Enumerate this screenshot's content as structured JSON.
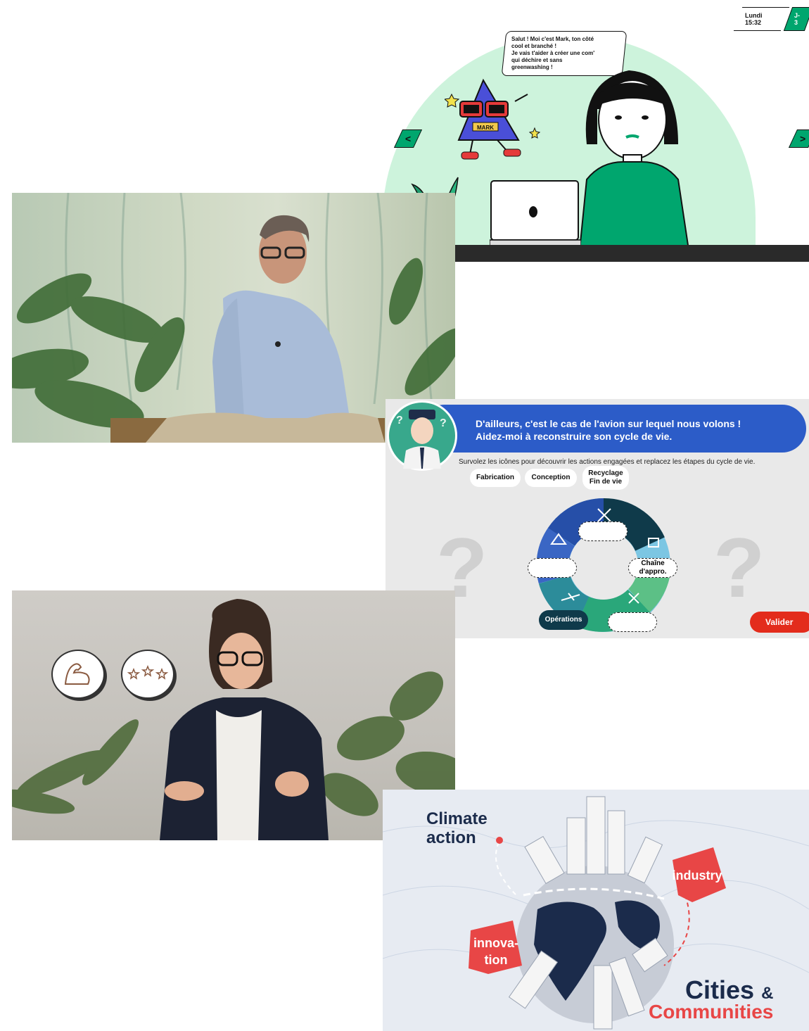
{
  "panel_mark": {
    "clock_time": "Lundi 15:32",
    "clock_day": "J-3",
    "speech": "Salut ! Moi c'est Mark, ton côté\ncool et branché !\nJe vais t'aider à créer une com'\nqui déchire et sans\ngreenwashing !",
    "character_label": "MARK",
    "nav_prev": "<",
    "nav_next": ">",
    "colors": {
      "accent": "#00a66e",
      "background_mint": "#cdf3dc"
    }
  },
  "panel_cycle": {
    "banner_line1": "D'ailleurs, c'est le cas de l'avion sur lequel nous volons !",
    "banner_line2": "Aidez-moi à reconstruire son cycle de vie.",
    "instruction": "Survolez les icônes pour découvrir les actions engagées et replacez les étapes du cycle de vie.",
    "chips": [
      "Fabrication",
      "Conception",
      "Recyclage\nFin de vie"
    ],
    "placed_supply": "Chaîne\nd'appro.",
    "placed_operations": "Opérations",
    "validate": "Valider",
    "colors": {
      "banner": "#2c5cc8",
      "validate": "#e32c1c"
    }
  },
  "panel_cities": {
    "title": "Climate\naction",
    "tag_industry": "industry",
    "tag_innovation": "innova-\ntion",
    "cities": "Cities",
    "amp": "&",
    "communities": "Communities",
    "colors": {
      "navy": "#1b2b4b",
      "red": "#e84646"
    }
  }
}
